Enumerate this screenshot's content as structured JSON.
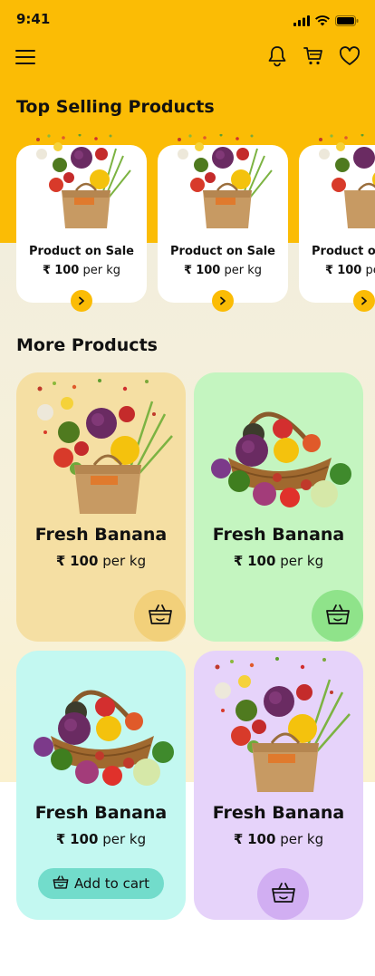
{
  "status_bar": {
    "time": "9:41"
  },
  "header": {
    "menu_icon": "hamburger-icon",
    "icons": [
      "bell-icon",
      "cart-icon",
      "heart-icon"
    ]
  },
  "top_selling": {
    "title": "Top Selling Products",
    "items": [
      {
        "name": "Product on Sale",
        "currency": "₹",
        "amount": "100",
        "unit": "per kg"
      },
      {
        "name": "Product on Sale",
        "currency": "₹",
        "amount": "100",
        "unit": "per kg"
      },
      {
        "name": "Product on Sale",
        "currency": "₹",
        "amount": "100",
        "unit": "per kg"
      }
    ]
  },
  "more_products": {
    "title": "More Products",
    "items": [
      {
        "name": "Fresh Banana",
        "currency": "₹",
        "amount": "100",
        "unit": "per kg",
        "bg": "#F5DFA3",
        "btn_bg": "#F2D07A",
        "image": "grocery-bag"
      },
      {
        "name": "Fresh Banana",
        "currency": "₹",
        "amount": "100",
        "unit": "per kg",
        "bg": "#C4F5C0",
        "btn_bg": "#8FE38A",
        "image": "vegetable-basket"
      },
      {
        "name": "Fresh Banana",
        "currency": "₹",
        "amount": "100",
        "unit": "per kg",
        "bg": "#C3F8F1",
        "btn_bg": "#72DCCB",
        "image": "vegetable-basket",
        "add_to_cart_label": "Add to cart"
      },
      {
        "name": "Fresh Banana",
        "currency": "₹",
        "amount": "100",
        "unit": "per kg",
        "bg": "#E6D3FA",
        "btn_bg": "#D1AEF2",
        "image": "grocery-bag"
      }
    ]
  },
  "colors": {
    "brand": "#FBBC05",
    "arrow_bg": "#FBBC05"
  }
}
